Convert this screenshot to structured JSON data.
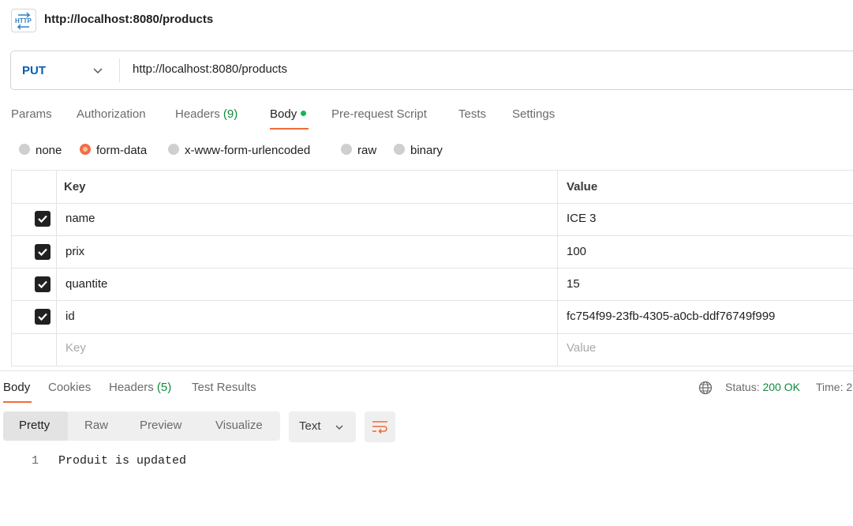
{
  "request": {
    "title": "http://localhost:8080/products",
    "icon": "http-request-icon",
    "method": "PUT",
    "url": "http://localhost:8080/products"
  },
  "request_tabs": {
    "params": "Params",
    "authorization": "Authorization",
    "headers": "Headers",
    "headers_count": "(9)",
    "body": "Body",
    "pre_request": "Pre-request Script",
    "tests": "Tests",
    "settings": "Settings"
  },
  "body_modes": {
    "none": "none",
    "form_data": "form-data",
    "urlencoded": "x-www-form-urlencoded",
    "raw": "raw",
    "binary": "binary",
    "selected": "form-data"
  },
  "form_table": {
    "headers": {
      "key": "Key",
      "value": "Value"
    },
    "rows": [
      {
        "key": "name",
        "value": "ICE 3",
        "checked": true
      },
      {
        "key": "prix",
        "value": "100",
        "checked": true
      },
      {
        "key": "quantite",
        "value": "15",
        "checked": true
      },
      {
        "key": "id",
        "value": "fc754f99-23fb-4305-a0cb-ddf76749f999",
        "checked": true
      }
    ],
    "placeholder_key": "Key",
    "placeholder_value": "Value"
  },
  "response_tabs": {
    "body": "Body",
    "cookies": "Cookies",
    "headers": "Headers",
    "headers_count": "(5)",
    "test_results": "Test Results"
  },
  "response_status": {
    "status_label": "Status:",
    "status_value": "200 OK",
    "time_label": "Time: 2"
  },
  "view_modes": {
    "pretty": "Pretty",
    "raw": "Raw",
    "preview": "Preview",
    "visualize": "Visualize",
    "format": "Text"
  },
  "response_body": {
    "line_number": "1",
    "line_text": "Produit is updated"
  },
  "colors": {
    "accent": "#f26b3a",
    "method": "#0a5fb4",
    "success": "#0f8a3f",
    "body_dot": "#0cbb52"
  }
}
